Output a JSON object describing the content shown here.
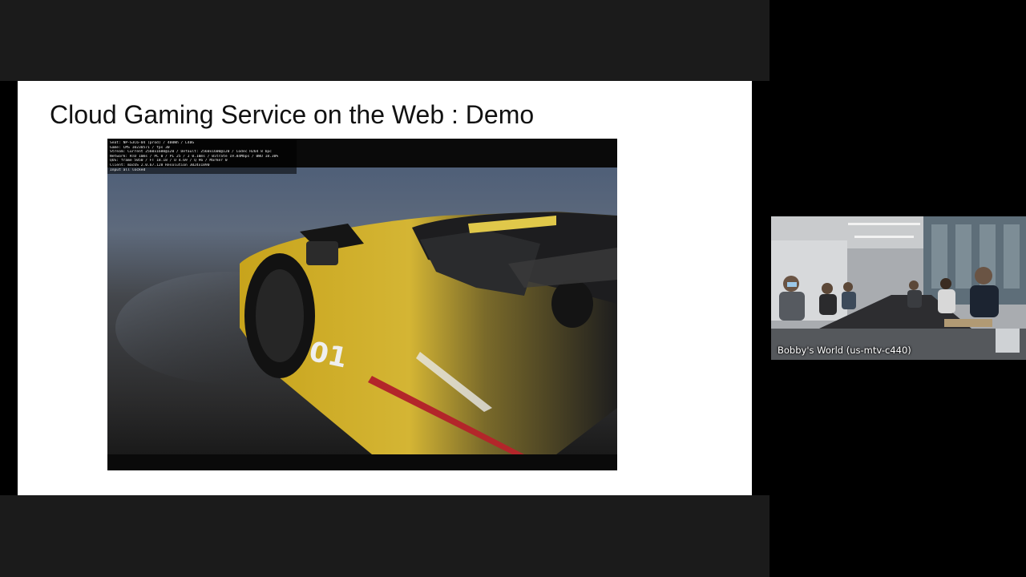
{
  "slide": {
    "title": "Cloud Gaming Service on the Web : Demo"
  },
  "stream_stats": {
    "lines": [
      "Seat: NP-S3C6-04 (prod) / 400Wh / L40G",
      "Game: CMS 10230571 / fps 30",
      "Stream: Current 2560x1600@120 / Default: 2560x1600@120 / Codec H264 8 bpc",
      "Network: RTD 10ms / PL 0 / PL 25 / J 0.10ms / Bitrate 19.84Mbps / BWU 18.30%",
      "QOS: frame 5050 / FT 18.18 / D 4.69 / Q 96 / Marker 0",
      "Client: macOS 2.0.67.128  Resolution 3024x1890",
      "Input all locked"
    ]
  },
  "participant": {
    "name": "Bobby's World (us-mtv-c440)"
  }
}
